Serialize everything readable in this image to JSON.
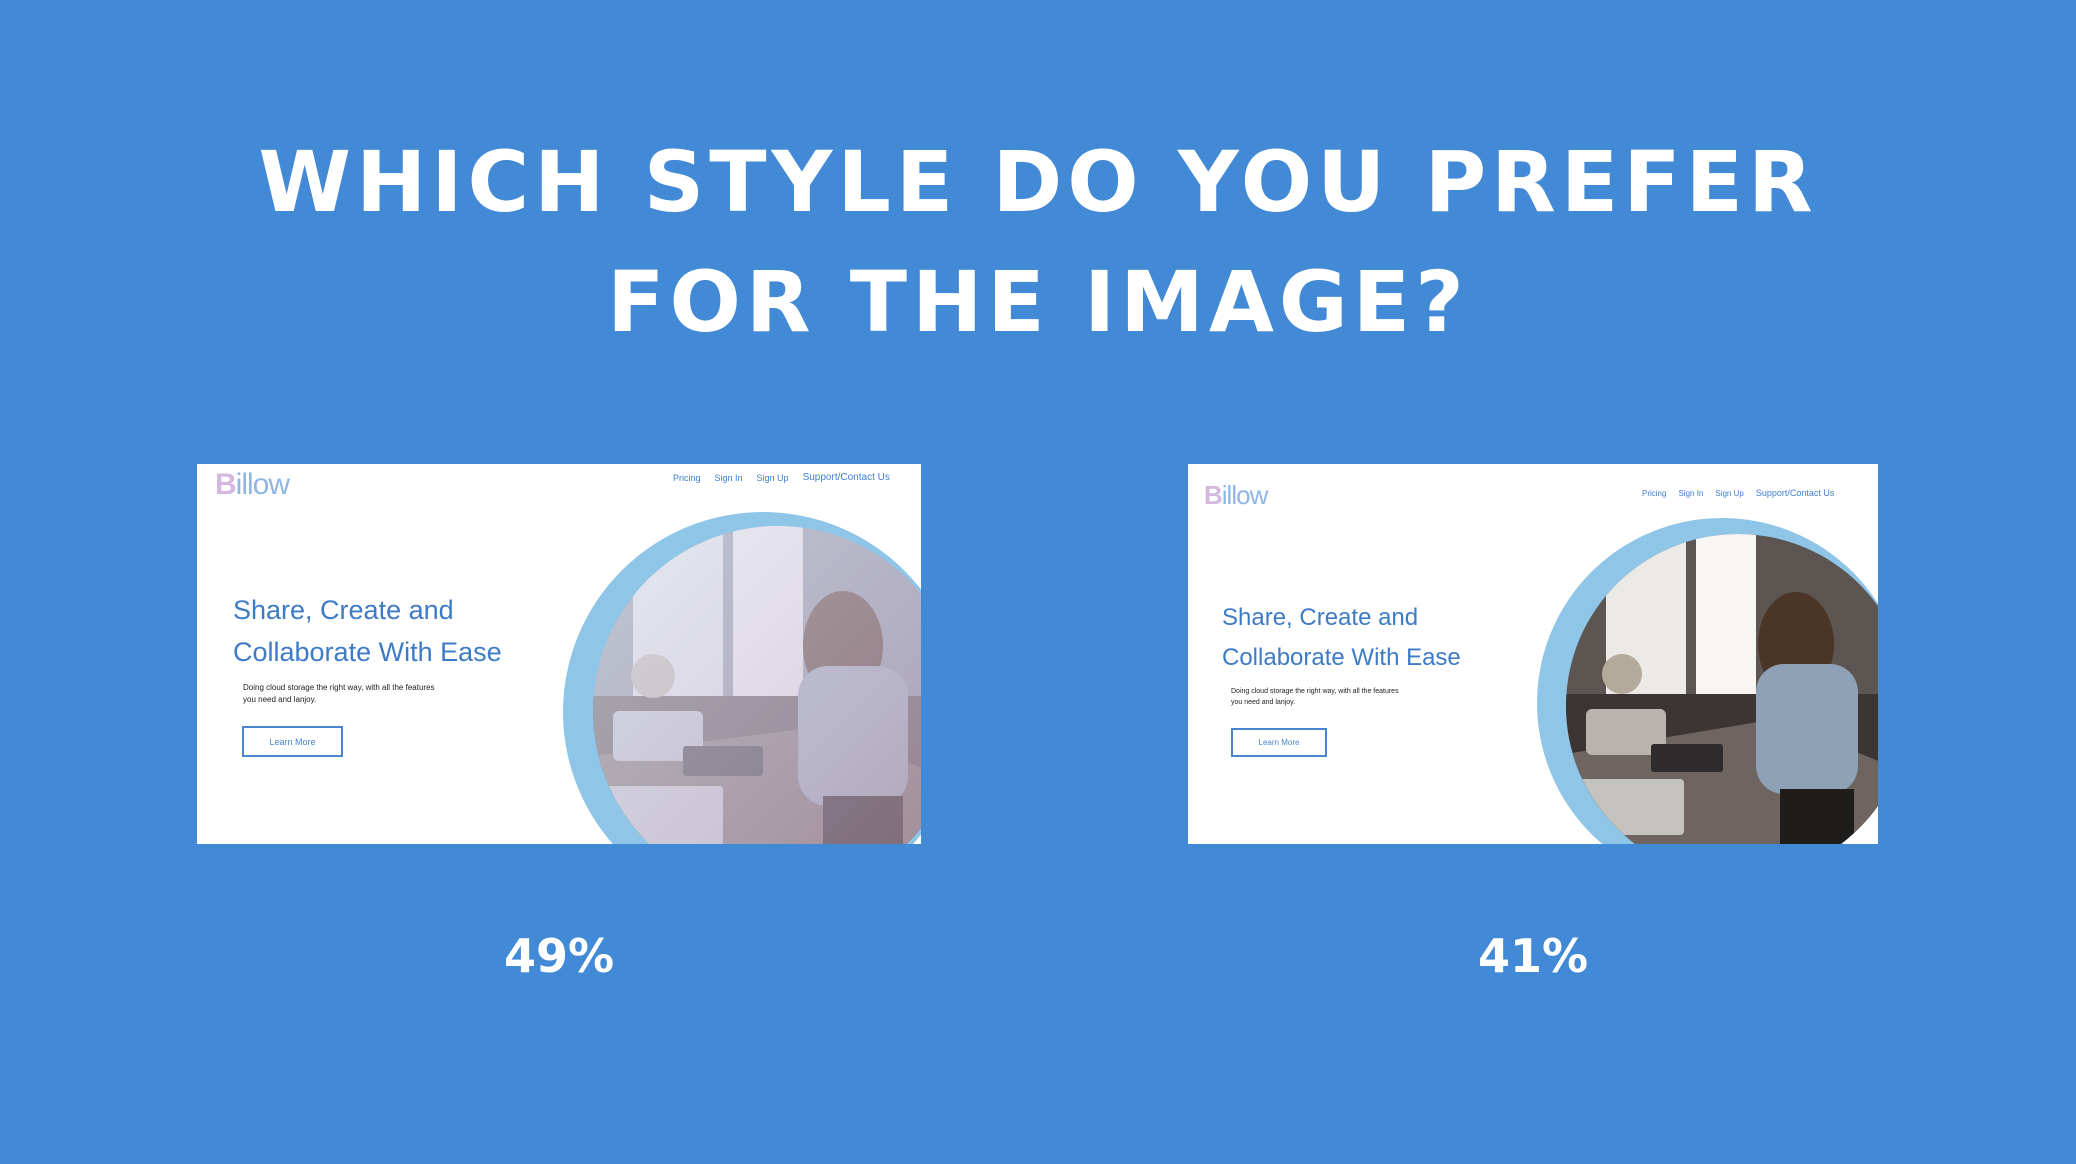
{
  "headline": {
    "line1": "WHICH STYLE DO YOU PREFER",
    "line2": "FOR THE IMAGE?"
  },
  "options": [
    {
      "style": "gradient-overlay",
      "logo": {
        "first": "B",
        "rest": "illow"
      },
      "nav": [
        "Pricing",
        "Sign In",
        "Sign Up",
        "Support/Contact Us"
      ],
      "hero_title": [
        "Share, Create and",
        "Collaborate With Ease"
      ],
      "hero_sub": [
        "Doing cloud storage the right way, with all the features",
        "you need and lanjoy."
      ],
      "button": "Learn More",
      "percent": "49%"
    },
    {
      "style": "natural",
      "logo": {
        "first": "B",
        "rest": "illow"
      },
      "nav": [
        "Pricing",
        "Sign In",
        "Sign Up",
        "Support/Contact Us"
      ],
      "hero_title": [
        "Share, Create and",
        "Collaborate With Ease"
      ],
      "hero_sub": [
        "Doing cloud storage the right way, with all the features",
        "you need and lanjoy."
      ],
      "button": "Learn More",
      "percent": "41%"
    }
  ],
  "colors": {
    "background": "#4289d6",
    "accent": "#3d7bc6",
    "ring": "#8fc6e8"
  }
}
